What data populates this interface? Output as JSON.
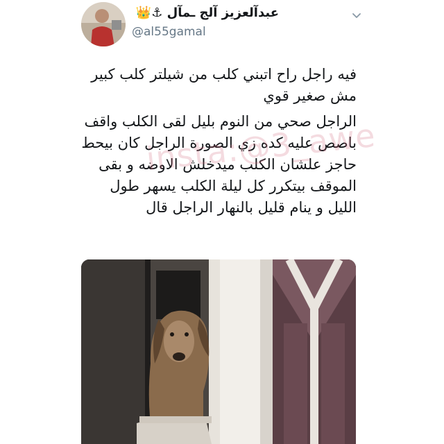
{
  "tweet": {
    "display_name": "عبدآلعزيز آلج ـمآل ⚓👑",
    "handle": "@al55gamal",
    "paragraphs": [
      "فيه راجل راح اتبني كلب من شيلتر كلب كبير مش صغير قوي",
      "الراجل صحي من النوم بليل لقى الكلب واقف باصص عليه كده زي الصورة الراجل كان بيحط حاجز علشان الكلب ميدخلش الاوضه و بقى الموقف بيتكرر كل ليلة الكلب يسهر طول الليل و ينام قليل بالنهار الراجل قال"
    ],
    "watermark": "insta:@3_awe"
  },
  "icons": {
    "menu": "chevron-down-icon"
  },
  "colors": {
    "text": "#14171a",
    "secondary": "#657786",
    "background": "#ffffff"
  }
}
